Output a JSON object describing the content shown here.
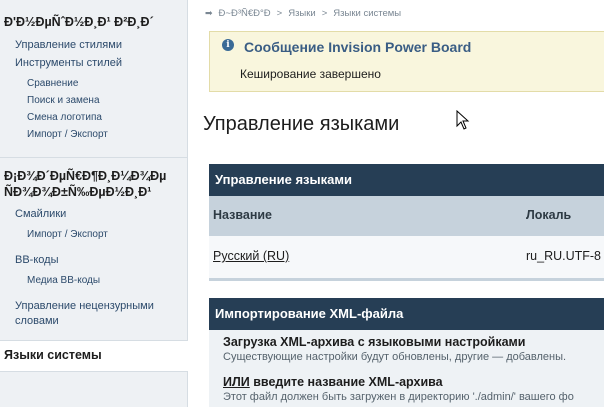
{
  "sidebar": {
    "section1": {
      "heading": "Ð'Ð½ÐµÑˆÐ½Ð¸Ð¹ Ð²Ð¸Ð´",
      "items": [
        {
          "label": "Управление стилями"
        },
        {
          "label": "Инструменты стилей"
        }
      ],
      "subitems": [
        {
          "label": "Сравнение"
        },
        {
          "label": "Поиск и замена"
        },
        {
          "label": "Смена логотипа"
        },
        {
          "label": "Импорт / Экспорт"
        }
      ]
    },
    "section2": {
      "heading_line1": "Ð¡Ð¾Ð´ÐµÑ€Ð¶Ð¸Ð¼Ð¾Ðµ",
      "heading_line2": "ÑÐ¾Ð¾Ð±Ñ‰ÐµÐ½Ð¸Ð¹",
      "smilies": "Смайлики",
      "smilies_sub": "Импорт / Экспорт",
      "bbcodes": "BB-коды",
      "bbcodes_sub": "Медиа BB-коды",
      "censor_line1": "Управление нецензурными",
      "censor_line2": "словами"
    },
    "active": "Языки системы"
  },
  "breadcrumb": {
    "items": [
      "Ð~Ð³Ñ€Ð°Ð",
      "Языки",
      "Языки системы"
    ],
    "separator": ">"
  },
  "message": {
    "title": "Сообщение Invision Power Board",
    "body": "Кеширование завершено",
    "icon": "i"
  },
  "page_title": "Управление языками",
  "languages_panel": {
    "title": "Управление языками",
    "col_name": "Название",
    "col_locale": "Локаль",
    "rows": [
      {
        "name": "Русский (RU)",
        "locale": "ru_RU.UTF-8"
      }
    ]
  },
  "import_panel": {
    "title": "Импортирование XML-файла",
    "upload_title": "Загрузка XML-архива с языковыми настройками",
    "upload_desc": "Существующие настройки будут обновлены, другие — добавлены.",
    "or_label": "ИЛИ",
    "enter_title": "введите название XML-архива",
    "enter_desc": "Этот файл должен быть загружен в директорию './admin/' вашего фо"
  },
  "colors": {
    "panel_header": "#263e55",
    "table_header": "#c6d2dc",
    "message_bg": "#f9f6dd",
    "message_title": "#3a5d84",
    "sidebar_bg": "#eef1f4"
  }
}
